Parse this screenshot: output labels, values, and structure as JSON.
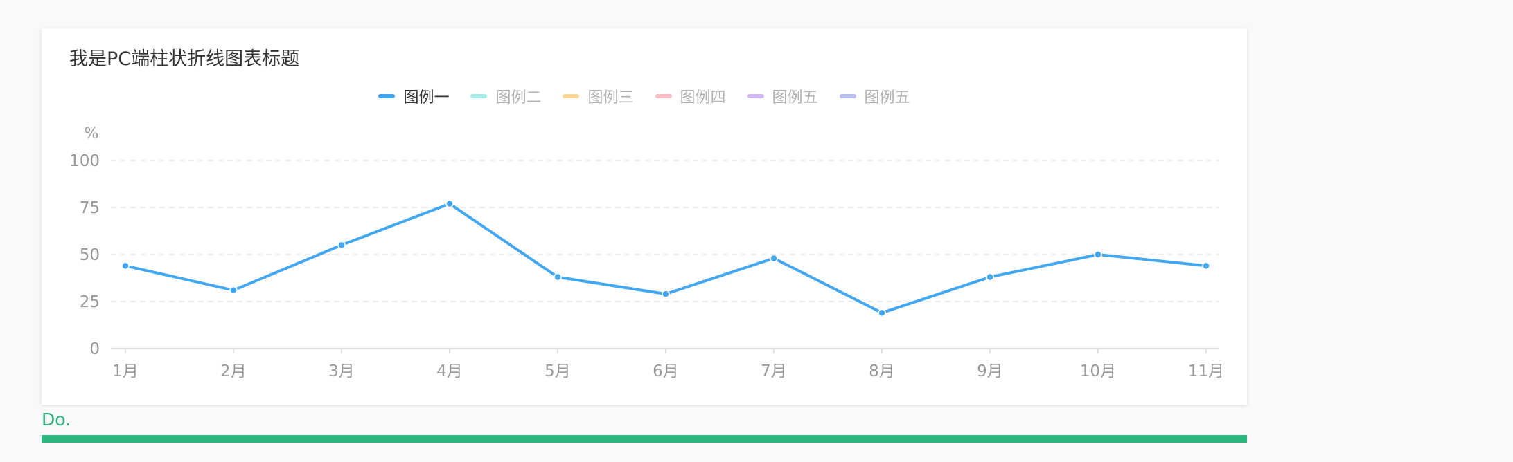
{
  "card": {
    "title": "我是PC端柱状折线图表标题"
  },
  "legend": [
    {
      "label": "图例一",
      "color": "#42a7f0",
      "active": true
    },
    {
      "label": "图例二",
      "color": "#a6ece7",
      "active": false
    },
    {
      "label": "图例三",
      "color": "#fbd99b",
      "active": false
    },
    {
      "label": "图例四",
      "color": "#f9bec6",
      "active": false
    },
    {
      "label": "图例五",
      "color": "#d3b8f0",
      "active": false
    },
    {
      "label": "图例五",
      "color": "#b9c0f2",
      "active": false
    }
  ],
  "chart_data": {
    "type": "line",
    "title": "我是PC端柱状折线图表标题",
    "ylabel": "%",
    "xlabel": "",
    "categories": [
      "1月",
      "2月",
      "3月",
      "4月",
      "5月",
      "6月",
      "7月",
      "8月",
      "9月",
      "10月",
      "11月"
    ],
    "yticks": [
      0,
      25,
      50,
      75,
      100
    ],
    "ylim": [
      0,
      100
    ],
    "grid": true,
    "legend_position": "top-center",
    "series": [
      {
        "name": "图例一",
        "color": "#42a7f0",
        "values": [
          44,
          31,
          55,
          77,
          38,
          29,
          48,
          19,
          38,
          50,
          44
        ]
      }
    ]
  },
  "footer": {
    "note": "Do.",
    "accent_color": "#2db37d"
  }
}
